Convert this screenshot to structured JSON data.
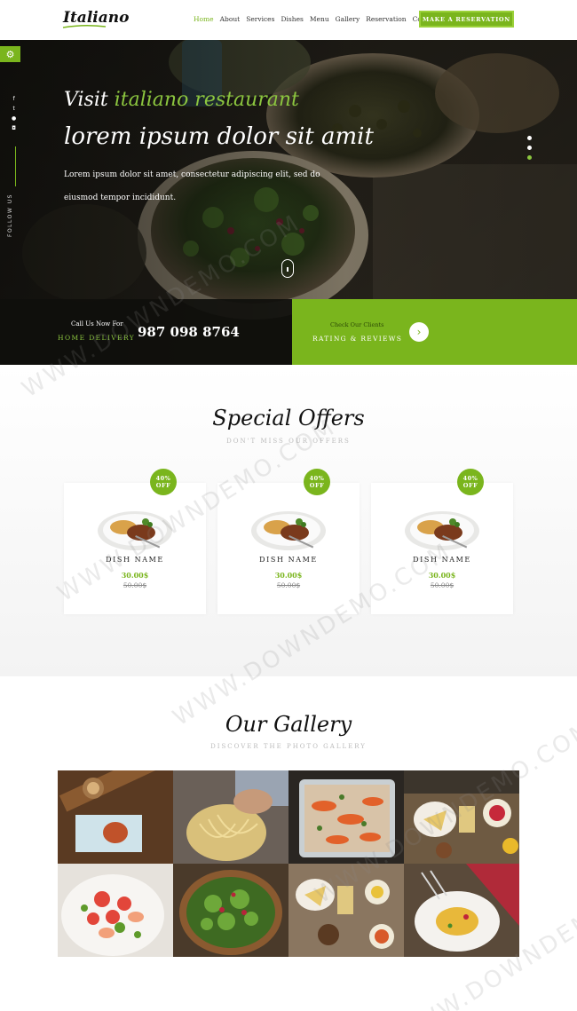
{
  "header": {
    "logo": "Italiano",
    "nav": [
      "Home",
      "About",
      "Services",
      "Dishes",
      "Menu",
      "Gallery",
      "Reservation",
      "Contact"
    ],
    "active_nav": "Home",
    "reserve_button": "MAKE A RESERVATION"
  },
  "hero": {
    "line1_prefix": "Visit",
    "line1_highlight": "italiano restaurant",
    "line2": "lorem ipsum dolor sit amit",
    "paragraph": "Lorem ipsum dolor sit amet, consectetur adipiscing elit, sed do eiusmod tempor incididunt.",
    "follow_label": "FOLLOW US",
    "social_icons": [
      "facebook-icon",
      "twitter-icon",
      "pinterest-icon",
      "instagram-icon"
    ],
    "slider_dots": 3,
    "active_dot": 3
  },
  "call": {
    "small": "Call Us Now For",
    "label": "HOME DELIVERY",
    "phone": "987 098 8764"
  },
  "rating": {
    "small": "Check Our Clients",
    "label": "RATING & REVIEWS"
  },
  "offers": {
    "title": "Special Offers",
    "subtitle": "DON'T MISS OUR OFFERS",
    "cards": [
      {
        "badge_pct": "40%",
        "badge_word": "OFF",
        "name": "DISH NAME",
        "price": "30.00$",
        "old_price": "50.00$"
      },
      {
        "badge_pct": "40%",
        "badge_word": "OFF",
        "name": "DISH NAME",
        "price": "30.00$",
        "old_price": "50.00$"
      },
      {
        "badge_pct": "40%",
        "badge_word": "OFF",
        "name": "DISH NAME",
        "price": "30.00$",
        "old_price": "50.00$"
      }
    ]
  },
  "gallery": {
    "title": "Our Gallery",
    "subtitle": "DISCOVER THE PHOTO GALLERY"
  },
  "watermark": "WWW.DOWNDEMO.COM",
  "colors": {
    "accent": "#7ab51d",
    "accent_light": "#8cc63f",
    "dark": "#111111"
  }
}
